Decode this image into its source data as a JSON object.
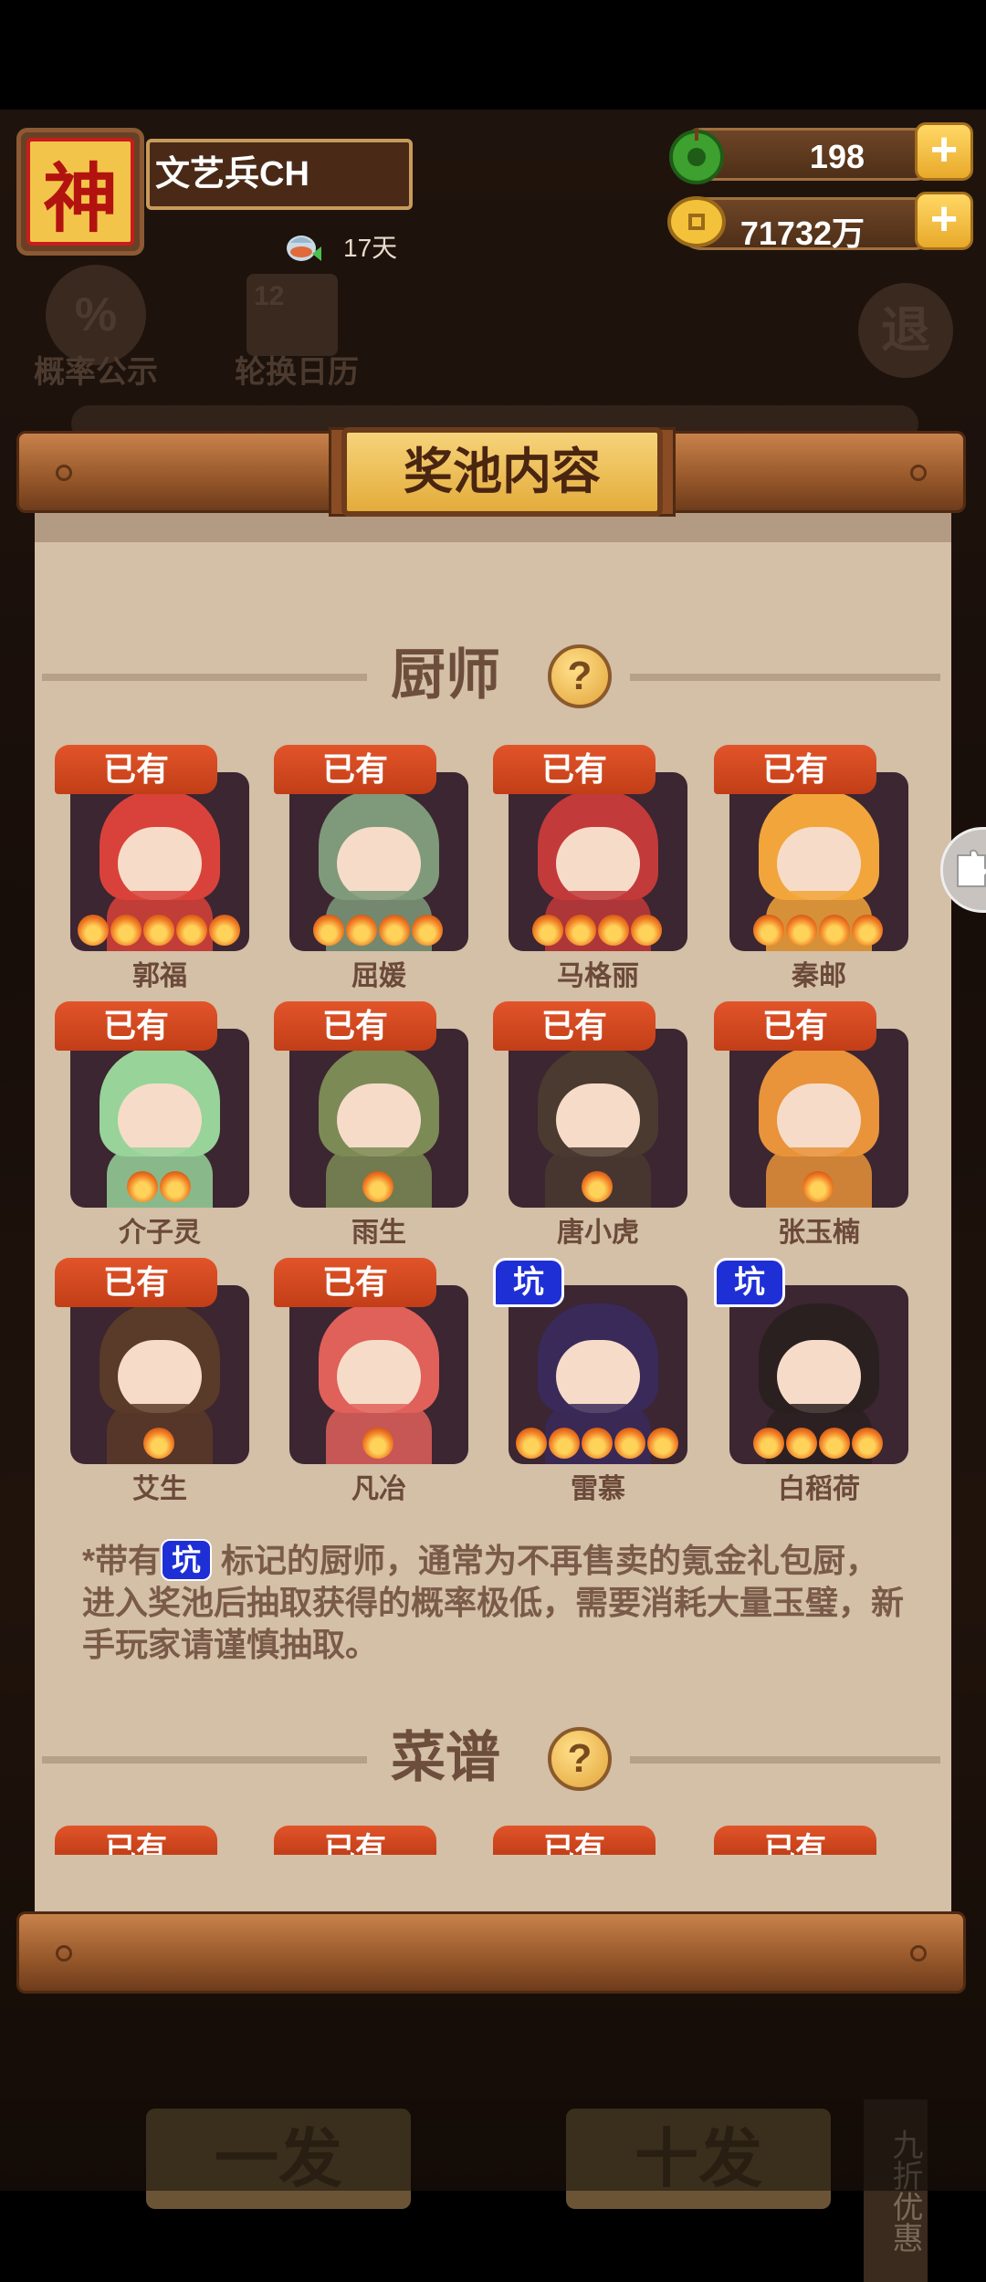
{
  "player": {
    "avatar_char": "神",
    "name": "文艺兵CH",
    "days": "17天"
  },
  "resources": {
    "jade": "198",
    "coins": "71732万"
  },
  "background_menu": {
    "probability_label": "概率公示",
    "probability_icon": "%",
    "calendar_label": "轮换日历",
    "calendar_icon": "12",
    "exit_label": "退",
    "draw_one": "一发",
    "draw_ten": "十发",
    "discount": "九折优惠"
  },
  "panel": {
    "title": "奖池内容",
    "chef_section": "厨师",
    "help_symbol": "?",
    "recipe_section": "菜谱",
    "note_prefix": "*带有",
    "note_tag": "坑",
    "note_body": " 标记的厨师，通常为不再售卖的氪金礼包厨，进入奖池后抽取获得的概率极低，需要消耗大量玉璧，新手玩家请谨慎抽取。"
  },
  "chefs": [
    {
      "name": "郭福",
      "tag": "已有",
      "tag_type": "owned",
      "stars": 5,
      "color": "#d9423a"
    },
    {
      "name": "屈媛",
      "tag": "已有",
      "tag_type": "owned",
      "stars": 4,
      "color": "#7f9a7a"
    },
    {
      "name": "马格丽",
      "tag": "已有",
      "tag_type": "owned",
      "stars": 4,
      "color": "#c23a3a"
    },
    {
      "name": "秦邮",
      "tag": "已有",
      "tag_type": "owned",
      "stars": 4,
      "color": "#f2a53a"
    },
    {
      "name": "介子灵",
      "tag": "已有",
      "tag_type": "owned",
      "stars": 2,
      "color": "#98d39a"
    },
    {
      "name": "雨生",
      "tag": "已有",
      "tag_type": "owned",
      "stars": 1,
      "color": "#7c8a55"
    },
    {
      "name": "唐小虎",
      "tag": "已有",
      "tag_type": "owned",
      "stars": 1,
      "color": "#4a3a30"
    },
    {
      "name": "张玉楠",
      "tag": "已有",
      "tag_type": "owned",
      "stars": 1,
      "color": "#e9933a"
    },
    {
      "name": "艾生",
      "tag": "已有",
      "tag_type": "owned",
      "stars": 1,
      "color": "#5a3a28"
    },
    {
      "name": "凡冶",
      "tag": "已有",
      "tag_type": "owned",
      "stars": 1,
      "color": "#e0605a"
    },
    {
      "name": "雷慕",
      "tag": "坑",
      "tag_type": "pit",
      "stars": 5,
      "color": "#3a2a5a"
    },
    {
      "name": "白稻荷",
      "tag": "坑",
      "tag_type": "pit",
      "stars": 4,
      "color": "#2a2020"
    }
  ],
  "recipes": [
    {
      "tag": "已有"
    },
    {
      "tag": "已有"
    },
    {
      "tag": "已有"
    },
    {
      "tag": "已有"
    }
  ]
}
